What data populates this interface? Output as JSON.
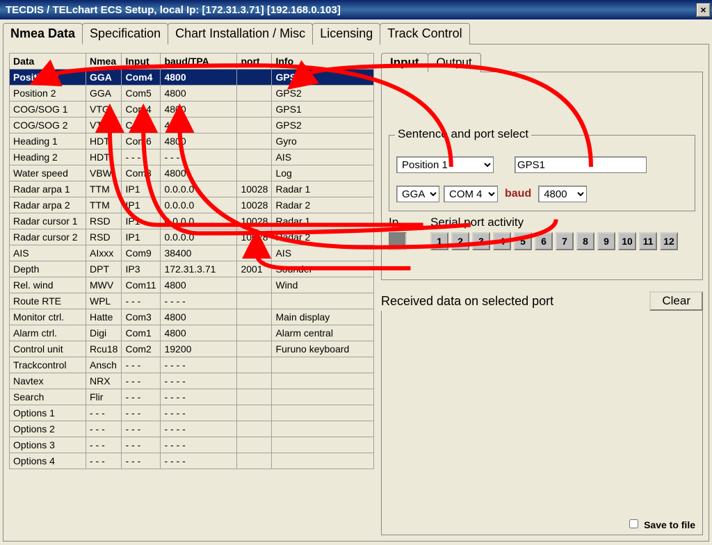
{
  "title": "TECDIS / TELchart ECS Setup,     local Ip: [172.31.3.71] [192.168.0.103]",
  "close_x": "×",
  "main_tabs": [
    "Nmea Data",
    "Specification",
    "Chart Installation / Misc",
    "Licensing",
    "Track Control"
  ],
  "table": {
    "headers": [
      "Data",
      "Nmea",
      "Input",
      "baud/TPA",
      "port",
      "Info"
    ],
    "rows": [
      {
        "d": "Position 1",
        "n": "GGA",
        "i": "Com4",
        "b": "4800",
        "p": "",
        "f": "GPS1",
        "sel": true
      },
      {
        "d": "Position 2",
        "n": "GGA",
        "i": "Com5",
        "b": "4800",
        "p": "",
        "f": "GPS2"
      },
      {
        "d": "COG/SOG 1",
        "n": "VTG",
        "i": "Com4",
        "b": "4800",
        "p": "",
        "f": "GPS1"
      },
      {
        "d": "COG/SOG 2",
        "n": "VTG",
        "i": "Com5",
        "b": "4800",
        "p": "",
        "f": "GPS2"
      },
      {
        "d": "Heading 1",
        "n": "HDT",
        "i": "Com6",
        "b": "4800",
        "p": "",
        "f": "Gyro"
      },
      {
        "d": "Heading 2",
        "n": "HDT",
        "i": "- - -",
        "b": "- - -",
        "p": "",
        "f": "AIS"
      },
      {
        "d": "Water speed",
        "n": "VBW",
        "i": "Com3",
        "b": "4800",
        "p": "",
        "f": "Log"
      },
      {
        "d": "Radar arpa 1",
        "n": "TTM",
        "i": "IP1",
        "b": "0.0.0.0",
        "p": "10028",
        "f": "Radar 1"
      },
      {
        "d": "Radar arpa 2",
        "n": "TTM",
        "i": "IP1",
        "b": "0.0.0.0",
        "p": "10028",
        "f": "Radar 2"
      },
      {
        "d": "Radar cursor 1",
        "n": "RSD",
        "i": "IP1",
        "b": "0.0.0.0",
        "p": "10028",
        "f": "Radar 1"
      },
      {
        "d": "Radar cursor 2",
        "n": "RSD",
        "i": "IP1",
        "b": "0.0.0.0",
        "p": "10028",
        "f": "Radar 2"
      },
      {
        "d": "AIS",
        "n": "AIxxx",
        "i": "Com9",
        "b": "38400",
        "p": "",
        "f": "AIS"
      },
      {
        "d": "Depth",
        "n": "DPT",
        "i": "IP3",
        "b": "172.31.3.71",
        "p": "2001",
        "f": "Sounder"
      },
      {
        "d": "Rel. wind",
        "n": "MWV",
        "i": "Com11",
        "b": "4800",
        "p": "",
        "f": "Wind"
      },
      {
        "d": "Route    RTE",
        "n": "WPL",
        "i": "- - -",
        "b": "- - - -",
        "p": "",
        "f": ""
      },
      {
        "d": "Monitor ctrl.",
        "n": "Hatte",
        "i": "Com3",
        "b": "4800",
        "p": "",
        "f": "Main display"
      },
      {
        "d": "Alarm ctrl.",
        "n": "Digi",
        "i": "Com1",
        "b": "4800",
        "p": "",
        "f": "Alarm central"
      },
      {
        "d": "Control unit",
        "n": "Rcu18",
        "i": "Com2",
        "b": "19200",
        "p": "",
        "f": "Furuno keyboard"
      },
      {
        "d": "Trackcontrol",
        "n": "Ansch",
        "i": "- - -",
        "b": "- - - -",
        "p": "",
        "f": ""
      },
      {
        "d": "Navtex",
        "n": "NRX",
        "i": "- - -",
        "b": "- - - -",
        "p": "",
        "f": ""
      },
      {
        "d": "Search",
        "n": "Flir",
        "i": "- - -",
        "b": "- - - -",
        "p": "",
        "f": ""
      },
      {
        "d": "Options 1",
        "n": "- - -",
        "i": "- - -",
        "b": "- - - -",
        "p": "",
        "f": ""
      },
      {
        "d": "Options 2",
        "n": "- - -",
        "i": "- - -",
        "b": "- - - -",
        "p": "",
        "f": ""
      },
      {
        "d": "Options 3",
        "n": "- - -",
        "i": "- - -",
        "b": "- - - -",
        "p": "",
        "f": ""
      },
      {
        "d": "Options 4",
        "n": "- - -",
        "i": "- - -",
        "b": "- - - -",
        "p": "",
        "f": ""
      }
    ]
  },
  "io_tabs": [
    "Input",
    "Output"
  ],
  "sentence": {
    "legend": "Sentence and port select",
    "data_select": "Position 1",
    "info_input": "GPS1",
    "nmea_select": "GGA",
    "com_select": "COM 4",
    "baud_label": "baud",
    "baud_select": "4800"
  },
  "ip_label": "Ip",
  "activity_label": "Serial port activity",
  "activity_buttons": [
    "1",
    "2",
    "3",
    "4",
    "5",
    "6",
    "7",
    "8",
    "9",
    "10",
    "11",
    "12"
  ],
  "received_label": "Received data on selected port",
  "clear_label": "Clear",
  "save_label": "Save to file"
}
